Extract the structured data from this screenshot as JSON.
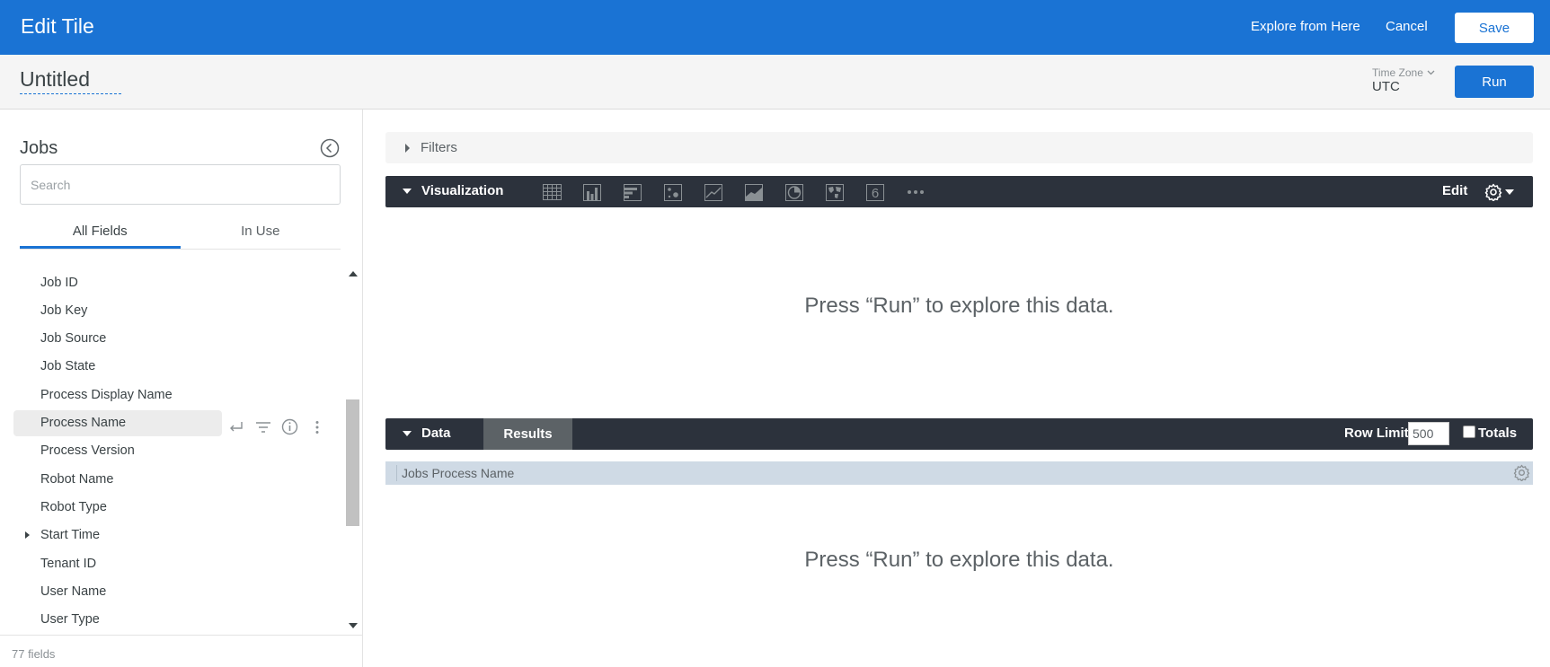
{
  "header": {
    "title": "Edit Tile",
    "explore_label": "Explore from Here",
    "cancel_label": "Cancel",
    "save_label": "Save"
  },
  "subheader": {
    "tile_title": "Untitled",
    "timezone_label": "Time Zone",
    "timezone_value": "UTC",
    "run_label": "Run"
  },
  "sidebar": {
    "explore_name": "Jobs",
    "search_placeholder": "Search",
    "tabs": [
      {
        "label": "All Fields",
        "active": true
      },
      {
        "label": "In Use",
        "active": false
      }
    ],
    "fields": [
      {
        "label": "Job ID"
      },
      {
        "label": "Job Key"
      },
      {
        "label": "Job Source"
      },
      {
        "label": "Job State"
      },
      {
        "label": "Process Display Name"
      },
      {
        "label": "Process Name",
        "hover": true
      },
      {
        "label": "Process Version"
      },
      {
        "label": "Robot Name"
      },
      {
        "label": "Robot Type"
      },
      {
        "label": "Start Time",
        "expandable": true
      },
      {
        "label": "Tenant ID"
      },
      {
        "label": "User Name"
      },
      {
        "label": "User Type"
      }
    ],
    "field_count": "77 fields"
  },
  "filters": {
    "label": "Filters"
  },
  "visualization": {
    "label": "Visualization",
    "icons": [
      "table-icon",
      "column-chart-icon",
      "bar-chart-icon",
      "scatter-icon",
      "line-chart-icon",
      "area-chart-icon",
      "pie-chart-icon",
      "map-icon",
      "single-value-icon",
      "more-icon"
    ],
    "single_value_glyph": "6",
    "edit_label": "Edit",
    "empty_message": "Press “Run” to explore this data."
  },
  "data": {
    "label": "Data",
    "results_tab": "Results",
    "row_limit_label": "Row Limit",
    "row_limit_value": "500",
    "totals_label": "Totals",
    "column_header": "Jobs Process Name",
    "empty_message": "Press “Run” to explore this data."
  },
  "colors": {
    "brand_blue": "#1a73d4",
    "dark_bar": "#2c323c",
    "results_tab": "#5c6266",
    "column_header_bg": "#cfdae5"
  }
}
